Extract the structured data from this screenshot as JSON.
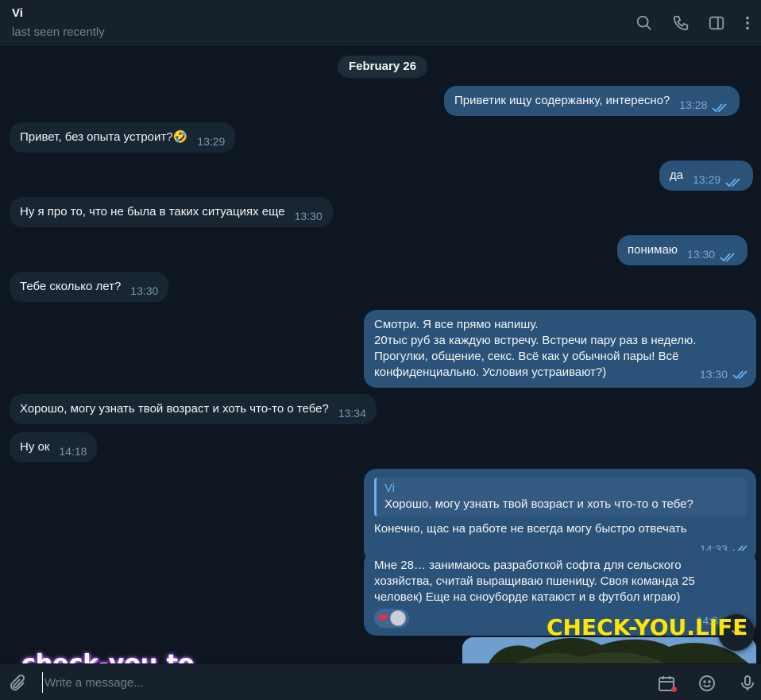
{
  "header": {
    "name": "Vi",
    "status": "last seen recently"
  },
  "chat": {
    "date": "February 26",
    "messages": [
      {
        "text": "Приветик ищу содержанку, интересно?",
        "time": "13:28"
      },
      {
        "text": "Привет, без опыта устроит?🤣",
        "time": "13:29"
      },
      {
        "text": "да",
        "time": "13:29"
      },
      {
        "text": "Ну я про то, что не была в таких ситуациях еще",
        "time": "13:30"
      },
      {
        "text": "понимаю",
        "time": "13:30"
      },
      {
        "text": "Тебе сколько лет?",
        "time": "13:30"
      },
      {
        "text": "Смотри. Я все прямо напишу.\n20тыс руб за каждую встречу. Встречи пару раз в неделю.\nПрогулки, общение, секс. Всё как у обычной пары! Всё\nконфиденциально. Условия устраивают?)",
        "time": "13:30"
      },
      {
        "text": "Хорошо, могу узнать твой возраст и хоть что-то о тебе?",
        "time": "13:34"
      },
      {
        "text": "Ну ок",
        "time": "14:18"
      },
      {
        "reply_name": "Vi",
        "reply_text": "Хорошо, могу узнать твой возраст и хоть что-то о тебе?",
        "text": "Конечно, щас на работе не всегда могу быстро отвечать",
        "time": "14:33"
      },
      {
        "text": "Мне 28… занимаюсь разработкой софта для сельского\nхозяйства, считай выращиваю пшеницу. Своя команда 25\nчеловек) Еще на сноуборде катаюст и в футбол играю)",
        "time": "14:3",
        "reaction": "❤"
      }
    ]
  },
  "watermarks": {
    "top": "CHECK-YOU.LIFE",
    "bottom": "check-you.to"
  },
  "composer": {
    "placeholder": "Write a message..."
  },
  "colors": {
    "background": "#0e1621",
    "header": "#17212b",
    "incoming": "#182533",
    "outgoing": "#2b5278",
    "accent": "#6ab2f2"
  },
  "icons": [
    "search-icon",
    "phone-icon",
    "sidebar-toggle-icon",
    "more-vertical-icon",
    "attach-icon",
    "schedule-icon",
    "emoji-icon",
    "microphone-icon",
    "scroll-down-icon"
  ]
}
